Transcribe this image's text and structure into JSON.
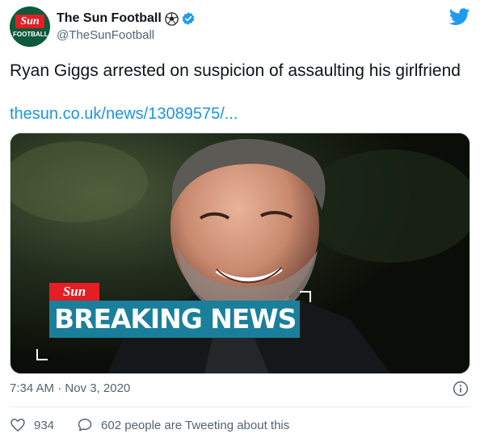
{
  "account": {
    "display_name": "The Sun Football",
    "handle": "@TheSunFootball",
    "avatar_brand": "Sun",
    "avatar_sub": "FOOTBALL",
    "verified": true,
    "badges": [
      "soccer-ball-icon",
      "verified-icon"
    ]
  },
  "tweet": {
    "text": "Ryan Giggs arrested on suspicion of assaulting his girlfriend",
    "link": "thesun.co.uk/news/13089575/...",
    "timestamp": "7:34 AM · Nov 3, 2020"
  },
  "media": {
    "brand": "Sun",
    "banner": "BREAKING NEWS"
  },
  "actions": {
    "likes": "934",
    "quote_text": "602 people are Tweeting about this"
  },
  "colors": {
    "link": "#1b95e0",
    "twitter_blue": "#1d9bf0",
    "banner_teal": "#1a7f9b",
    "sun_red": "#e31e24",
    "muted": "#536471"
  }
}
